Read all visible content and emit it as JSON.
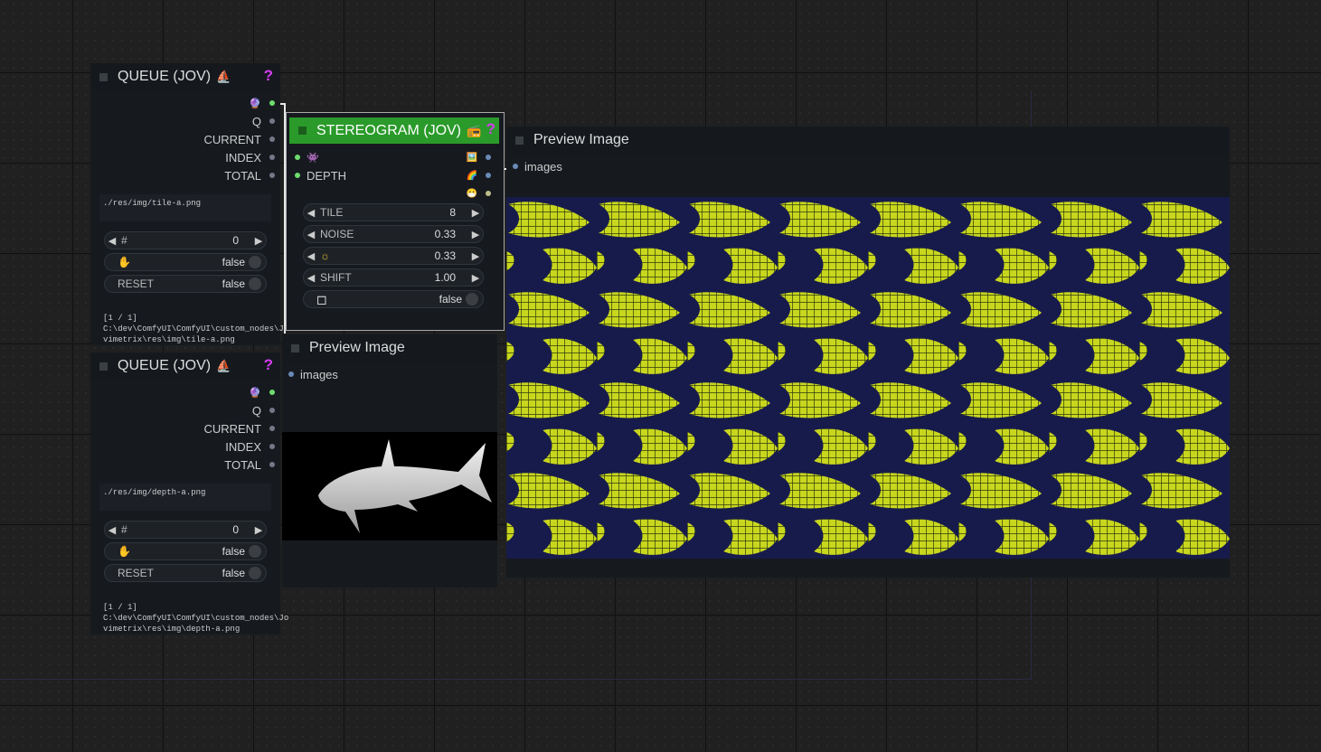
{
  "colors": {
    "background": "#202020",
    "node_body": "#161a1f",
    "stereogram_title": "#2a9a2a",
    "help_icon": "#d63cf0",
    "slot_green": "#6edc6e",
    "slot_blue": "#6a8ab8",
    "tile_yellow": "#c8d61e",
    "tile_dark": "#181c50"
  },
  "queue1": {
    "title": "QUEUE (JOV)",
    "title_icon": "⛵",
    "help": "?",
    "outputs": {
      "any_icon": "🔮",
      "q": "Q",
      "current": "CURRENT",
      "index": "INDEX",
      "total": "TOTAL"
    },
    "path_text": "./res/img/tile-a.png",
    "widget_index": {
      "label": "#",
      "value": "0"
    },
    "widget_hold": {
      "icon": "✋",
      "value": "false"
    },
    "widget_reset": {
      "label": "RESET",
      "value": "false"
    },
    "status_line1": "[1 / 1]",
    "status_line2": "C:\\dev\\ComfyUI\\ComfyUI\\custom_nodes\\Jo",
    "status_line3": "vimetrix\\res\\img\\tile-a.png"
  },
  "queue2": {
    "title": "QUEUE (JOV)",
    "title_icon": "⛵",
    "help": "?",
    "outputs": {
      "any_icon": "🔮",
      "q": "Q",
      "current": "CURRENT",
      "index": "INDEX",
      "total": "TOTAL"
    },
    "path_text": "./res/img/depth-a.png",
    "widget_index": {
      "label": "#",
      "value": "0"
    },
    "widget_hold": {
      "icon": "✋",
      "value": "false"
    },
    "widget_reset": {
      "label": "RESET",
      "value": "false"
    },
    "status_line1": "[1 / 1]",
    "status_line2": "C:\\dev\\ComfyUI\\ComfyUI\\custom_nodes\\Jo",
    "status_line3": "vimetrix\\res\\img\\depth-a.png"
  },
  "stereogram": {
    "title": "STEREOGRAM (JOV)",
    "title_icon": "📻",
    "help": "?",
    "input_pixel_icon": "👾",
    "input_depth": "DEPTH",
    "output_icons": [
      "🖼️",
      "🌈",
      "😷"
    ],
    "widgets": [
      {
        "label": "TILE",
        "value": "8"
      },
      {
        "label": "NOISE",
        "value": "0.33"
      },
      {
        "label": "☼",
        "value": "0.33"
      },
      {
        "label": "SHIFT",
        "value": "1.00"
      }
    ],
    "invert": {
      "icon": "◻",
      "value": "false"
    }
  },
  "preview_small": {
    "title": "Preview Image",
    "input": "images"
  },
  "preview_large": {
    "title": "Preview Image",
    "input": "images"
  }
}
